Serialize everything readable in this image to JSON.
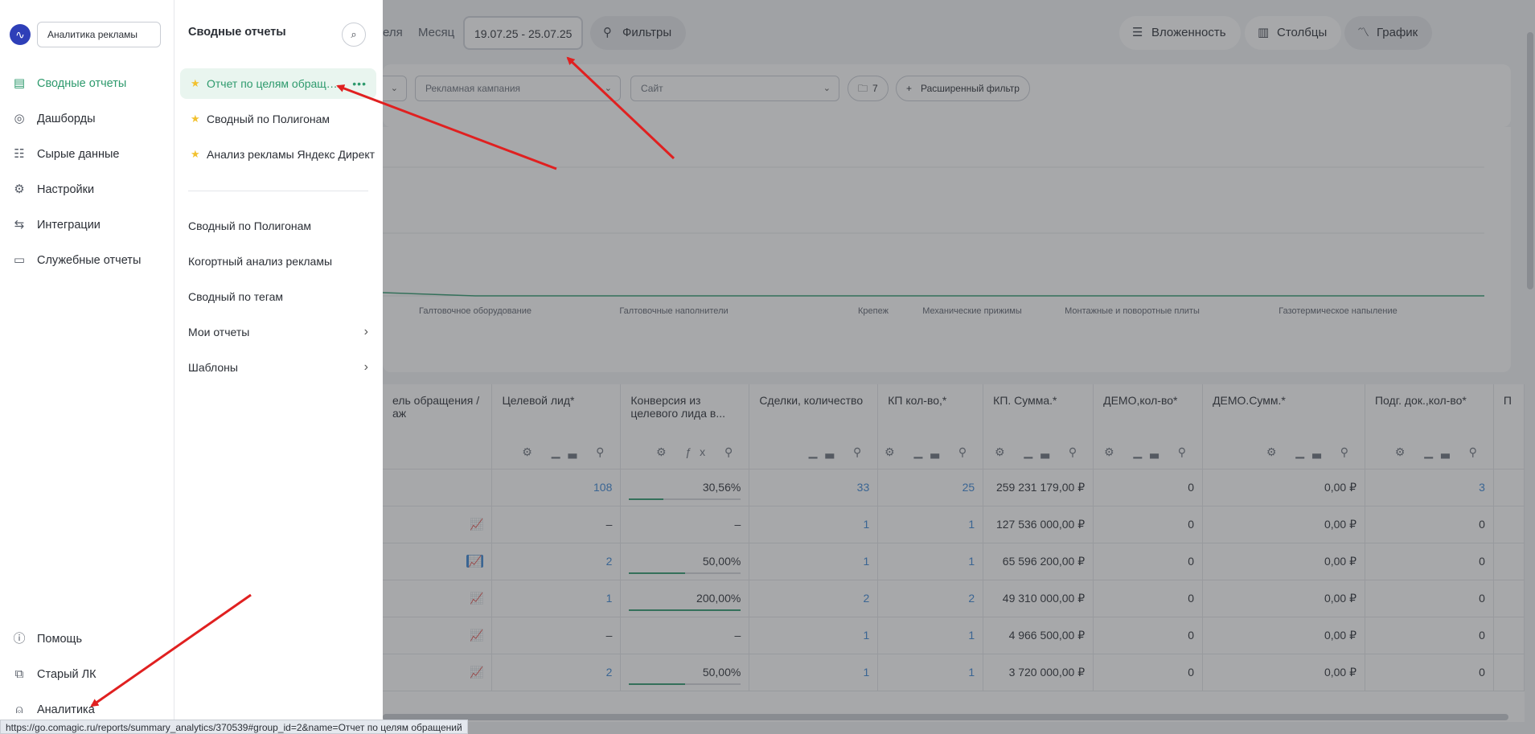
{
  "toolbar": {
    "period_week_partial": "еля",
    "period_month": "Месяц",
    "date_range": "19.07.25 - 25.07.25",
    "filters_label": "Фильтры",
    "nesting_label": "Вложенность",
    "columns_label": "Столбцы",
    "chart_label": "График"
  },
  "filterbar": {
    "campaign_placeholder": "Рекламная кампания",
    "site_placeholder": "Сайт",
    "folder_count": "7",
    "advanced_filter": "Расширенный фильтр"
  },
  "chart_data": {
    "type": "line",
    "categories": [
      "Галтовочное оборудование",
      "Галтовочные наполнители",
      "Крепеж",
      "Механические прижимы",
      "Монтажные и поворотные плиты",
      "Газотермическое напыление"
    ],
    "series": [
      {
        "values": [
          0,
          0,
          0,
          0,
          0,
          0
        ]
      }
    ],
    "grid": true,
    "color": "#2e9a6d"
  },
  "table": {
    "columns": [
      {
        "label": "ель обращения / аж",
        "icons": ""
      },
      {
        "label": "Целевой лид*",
        "icons": "⚙ ▁▃ ⚲"
      },
      {
        "label": "Конверсия из целевого лида в...",
        "icons": "⚙ ƒx ⚲"
      },
      {
        "label": "Сделки, количество",
        "icons": "▁▃ ⚲"
      },
      {
        "label": "КП кол-во,*",
        "icons": "⚙ ▁▃ ⚲"
      },
      {
        "label": "КП. Сумма.*",
        "icons": "⚙ ▁▃ ⚲"
      },
      {
        "label": "ДЕМО,кол-во*",
        "icons": "⚙ ▁▃ ⚲"
      },
      {
        "label": "ДЕМО.Сумм.*",
        "icons": "⚙ ▁▃ ⚲"
      },
      {
        "label": "Подг. док.,кол-во*",
        "icons": "⚙ ▁▃ ⚲"
      },
      {
        "label": "П",
        "icons": ""
      }
    ],
    "rows": [
      {
        "trend": "",
        "trend_active": false,
        "lead": "108",
        "conv": "30,56%",
        "conv_fill": 0.31,
        "deals": "33",
        "kp_count": "25",
        "kp_sum": "259 231 179,00 ₽",
        "demo_count": "0",
        "demo_sum": "0,00 ₽",
        "docs": "3"
      },
      {
        "trend": "📈",
        "trend_active": false,
        "lead": "–",
        "conv": "–",
        "conv_fill": 0,
        "deals": "1",
        "kp_count": "1",
        "kp_sum": "127 536 000,00 ₽",
        "demo_count": "0",
        "demo_sum": "0,00 ₽",
        "docs": "0"
      },
      {
        "trend": "📈",
        "trend_active": true,
        "lead": "2",
        "conv": "50,00%",
        "conv_fill": 0.5,
        "deals": "1",
        "kp_count": "1",
        "kp_sum": "65 596 200,00 ₽",
        "demo_count": "0",
        "demo_sum": "0,00 ₽",
        "docs": "0"
      },
      {
        "trend": "📈",
        "trend_active": false,
        "lead": "1",
        "conv": "200,00%",
        "conv_fill": 1.0,
        "deals": "2",
        "kp_count": "2",
        "kp_sum": "49 310 000,00 ₽",
        "demo_count": "0",
        "demo_sum": "0,00 ₽",
        "docs": "0"
      },
      {
        "trend": "📈",
        "trend_active": false,
        "lead": "–",
        "conv": "–",
        "conv_fill": 0,
        "deals": "1",
        "kp_count": "1",
        "kp_sum": "4 966 500,00 ₽",
        "demo_count": "0",
        "demo_sum": "0,00 ₽",
        "docs": "0"
      },
      {
        "trend": "📈",
        "trend_active": false,
        "lead": "2",
        "conv": "50,00%",
        "conv_fill": 0.5,
        "deals": "1",
        "kp_count": "1",
        "kp_sum": "3 720 000,00 ₽",
        "demo_count": "0",
        "demo_sum": "0,00 ₽",
        "docs": "0"
      }
    ]
  },
  "nav": {
    "app_selector": "Аналитика рекламы",
    "items": [
      {
        "label": "Сводные отчеты",
        "icon": "chart-icon"
      },
      {
        "label": "Дашборды",
        "icon": "dashboard-icon"
      },
      {
        "label": "Сырые данные",
        "icon": "list-icon"
      },
      {
        "label": "Настройки",
        "icon": "gear-icon"
      },
      {
        "label": "Интеграции",
        "icon": "integration-icon"
      },
      {
        "label": "Служебные отчеты",
        "icon": "document-icon"
      }
    ],
    "bottom": [
      {
        "label": "Помощь",
        "icon": "info-icon"
      },
      {
        "label": "Старый ЛК",
        "icon": "external-link-icon"
      },
      {
        "label": "Аналитика",
        "icon": "user-icon"
      }
    ]
  },
  "submenu": {
    "title": "Сводные отчеты",
    "favorites": [
      "Отчет по целям обращений",
      "Сводный по Полигонам",
      "Анализ рекламы Яндекс Директ"
    ],
    "reports": [
      "Сводный по Полигонам",
      "Когортный анализ рекламы",
      "Сводный по тегам",
      "Мои отчеты",
      "Шаблоны"
    ]
  },
  "status_url": "https://go.comagic.ru/reports/summary_analytics/370539#group_id=2&name=Отчет по целям обращений",
  "colors": {
    "accent": "#2e9a6d",
    "link": "#3a86d6",
    "annotation": "#e02020"
  }
}
